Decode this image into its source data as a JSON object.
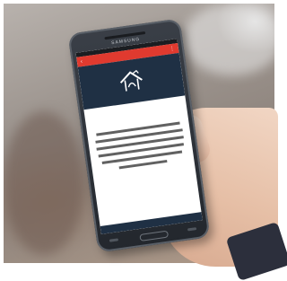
{
  "phone": {
    "brand": "SAMSUNG"
  },
  "screen": {
    "icons": {
      "back": "arrow-left-icon",
      "menu": "menu-icon",
      "logo": "house-logo-icon"
    },
    "colors": {
      "app_bar": "#e03a2f",
      "hero": "#1f3044"
    }
  }
}
